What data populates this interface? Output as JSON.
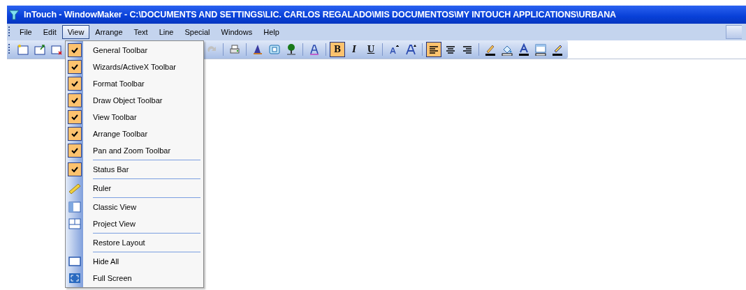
{
  "window": {
    "title": "InTouch - WindowMaker - C:\\DOCUMENTS AND SETTINGS\\LIC. CARLOS REGALADO\\MIS DOCUMENTOS\\MY INTOUCH APPLICATIONS\\URBANA"
  },
  "menu_bar": [
    {
      "label": "File",
      "selected": false
    },
    {
      "label": "Edit",
      "selected": false
    },
    {
      "label": "View",
      "selected": true
    },
    {
      "label": "Arrange",
      "selected": false
    },
    {
      "label": "Text",
      "selected": false
    },
    {
      "label": "Line",
      "selected": false
    },
    {
      "label": "Special",
      "selected": false
    },
    {
      "label": "Windows",
      "selected": false
    },
    {
      "label": "Help",
      "selected": false
    }
  ],
  "toolbar": [
    {
      "kind": "icon",
      "selected": false
    },
    {
      "kind": "icon",
      "selected": false
    },
    {
      "kind": "icon",
      "selected": false
    },
    {
      "kind": "gap"
    },
    {
      "kind": "icon",
      "selected": false
    },
    {
      "kind": "separator"
    },
    {
      "kind": "icon",
      "selected": false
    },
    {
      "kind": "separator"
    },
    {
      "kind": "icon",
      "selected": false
    },
    {
      "kind": "icon",
      "selected": false
    },
    {
      "kind": "icon",
      "selected": false
    },
    {
      "kind": "separator"
    },
    {
      "kind": "icon",
      "selected": false
    },
    {
      "kind": "separator"
    },
    {
      "kind": "glyph",
      "label": "B",
      "selected": true
    },
    {
      "kind": "glyph",
      "label": "I",
      "selected": false
    },
    {
      "kind": "glyph",
      "label": "U",
      "selected": false
    },
    {
      "kind": "separator"
    },
    {
      "kind": "icon",
      "selected": false
    },
    {
      "kind": "icon",
      "selected": false
    },
    {
      "kind": "separator"
    },
    {
      "kind": "icon",
      "selected": true
    },
    {
      "kind": "icon",
      "selected": false
    },
    {
      "kind": "icon",
      "selected": false
    },
    {
      "kind": "separator"
    },
    {
      "kind": "icon",
      "selected": false
    },
    {
      "kind": "icon",
      "selected": false
    },
    {
      "kind": "icon",
      "selected": false
    },
    {
      "kind": "icon",
      "selected": false
    },
    {
      "kind": "icon",
      "selected": false
    }
  ],
  "view_menu": {
    "groups": [
      [
        {
          "label": "General Toolbar",
          "kind": "check",
          "checked": true
        },
        {
          "label": "Wizards/ActiveX Toolbar",
          "kind": "check",
          "checked": true
        },
        {
          "label": "Format Toolbar",
          "kind": "check",
          "checked": true
        },
        {
          "label": "Draw Object Toolbar",
          "kind": "check",
          "checked": true
        },
        {
          "label": "View Toolbar",
          "kind": "check",
          "checked": true
        },
        {
          "label": "Arrange Toolbar",
          "kind": "check",
          "checked": true
        },
        {
          "label": "Pan and Zoom Toolbar",
          "kind": "check",
          "checked": true
        }
      ],
      [
        {
          "label": "Status Bar",
          "kind": "check",
          "checked": true
        }
      ],
      [
        {
          "label": "Ruler",
          "kind": "ruler"
        }
      ],
      [
        {
          "label": "Classic View",
          "kind": "classic"
        },
        {
          "label": "Project View",
          "kind": "project"
        }
      ],
      [
        {
          "label": "Restore Layout",
          "kind": "plain"
        }
      ],
      [
        {
          "label": "Hide All",
          "kind": "hide"
        },
        {
          "label": "Full Screen",
          "kind": "full"
        }
      ]
    ]
  }
}
